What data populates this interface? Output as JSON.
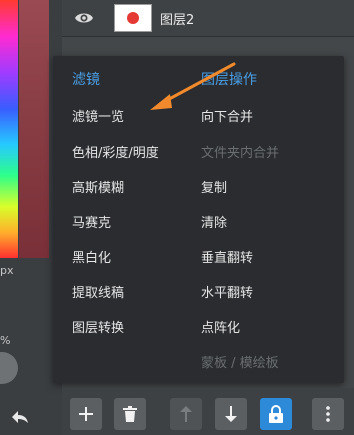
{
  "left_panel": {
    "px_label": "px",
    "percent_label": "%"
  },
  "layer_row": {
    "layer_name": "图层2"
  },
  "menu": {
    "filters_header": "滤镜",
    "layer_ops_header": "图层操作",
    "filters": [
      {
        "label": "滤镜一览",
        "enabled": true
      },
      {
        "label": "色相/彩度/明度",
        "enabled": true
      },
      {
        "label": "高斯模糊",
        "enabled": true
      },
      {
        "label": "马赛克",
        "enabled": true
      },
      {
        "label": "黑白化",
        "enabled": true
      },
      {
        "label": "提取线稿",
        "enabled": true
      },
      {
        "label": "图层转换",
        "enabled": true
      }
    ],
    "layer_ops": [
      {
        "label": "向下合并",
        "enabled": true
      },
      {
        "label": "文件夹内合并",
        "enabled": false
      },
      {
        "label": "复制",
        "enabled": true
      },
      {
        "label": "清除",
        "enabled": true
      },
      {
        "label": "垂直翻转",
        "enabled": true
      },
      {
        "label": "水平翻转",
        "enabled": true
      },
      {
        "label": "点阵化",
        "enabled": true
      },
      {
        "label": "蒙板 / 模绘板",
        "enabled": false
      }
    ]
  },
  "toolbar": {
    "buttons": [
      {
        "icon": "plus-icon",
        "enabled": true
      },
      {
        "icon": "trash-icon",
        "enabled": true
      },
      {
        "icon": "arrow-up-icon",
        "enabled": false
      },
      {
        "icon": "arrow-down-icon",
        "enabled": true
      },
      {
        "icon": "lock-icon",
        "enabled": true,
        "active": true
      },
      {
        "icon": "more-vertical-icon",
        "enabled": true
      }
    ]
  },
  "colors": {
    "accent": "#2d8ad8",
    "header": "#4a9ee6",
    "annotation_arrow": "#f08a2c",
    "layer_dot": "#e53935"
  }
}
